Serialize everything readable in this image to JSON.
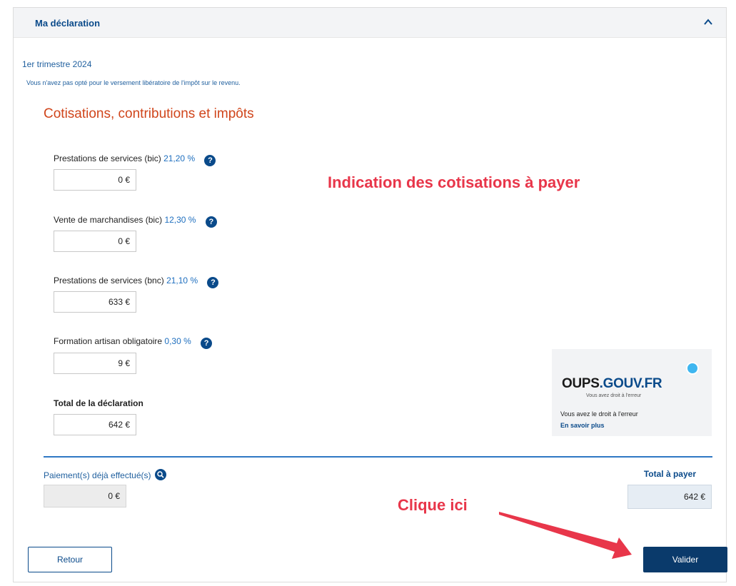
{
  "header": {
    "title": "Ma déclaration",
    "chevron_icon": "chevron-up-icon"
  },
  "period": "1er trimestre 2024",
  "notice": "Vous n'avez pas opté pour le versement libératoire de l'impôt sur le revenu.",
  "section_title": "Cotisations, contributions et impôts",
  "lines": [
    {
      "label": "Prestations de services (bic)",
      "rate": "21,20 %",
      "help": "?",
      "amount": "0 €"
    },
    {
      "label": "Vente de marchandises (bic)",
      "rate": "12,30 %",
      "help": "?",
      "amount": "0 €"
    },
    {
      "label": "Prestations de services (bnc)",
      "rate": "21,10 %",
      "help": "?",
      "amount": "633 €"
    },
    {
      "label": "Formation artisan obligatoire",
      "rate": "0,30 %",
      "help": "?",
      "amount": "9 €"
    }
  ],
  "total": {
    "label": "Total de la déclaration",
    "amount": "642 €"
  },
  "annotations": {
    "cotisations": "Indication des cotisations à payer",
    "click": "Clique ici"
  },
  "oups": {
    "logo_main": "OUPS",
    "logo_domain": ".GOUV.FR",
    "tagline": "Vous avez droit à l'erreur",
    "text": "Vous avez le droit à l'erreur",
    "link": "En savoir plus"
  },
  "payments": {
    "label": "Paiement(s) déjà effectué(s)",
    "amount": "0 €"
  },
  "to_pay": {
    "label": "Total à payer",
    "amount": "642 €"
  },
  "buttons": {
    "back": "Retour",
    "validate": "Valider"
  },
  "colors": {
    "brand": "#0a4a8a",
    "accent_title": "#d0451b",
    "annotation": "#e8364a"
  }
}
